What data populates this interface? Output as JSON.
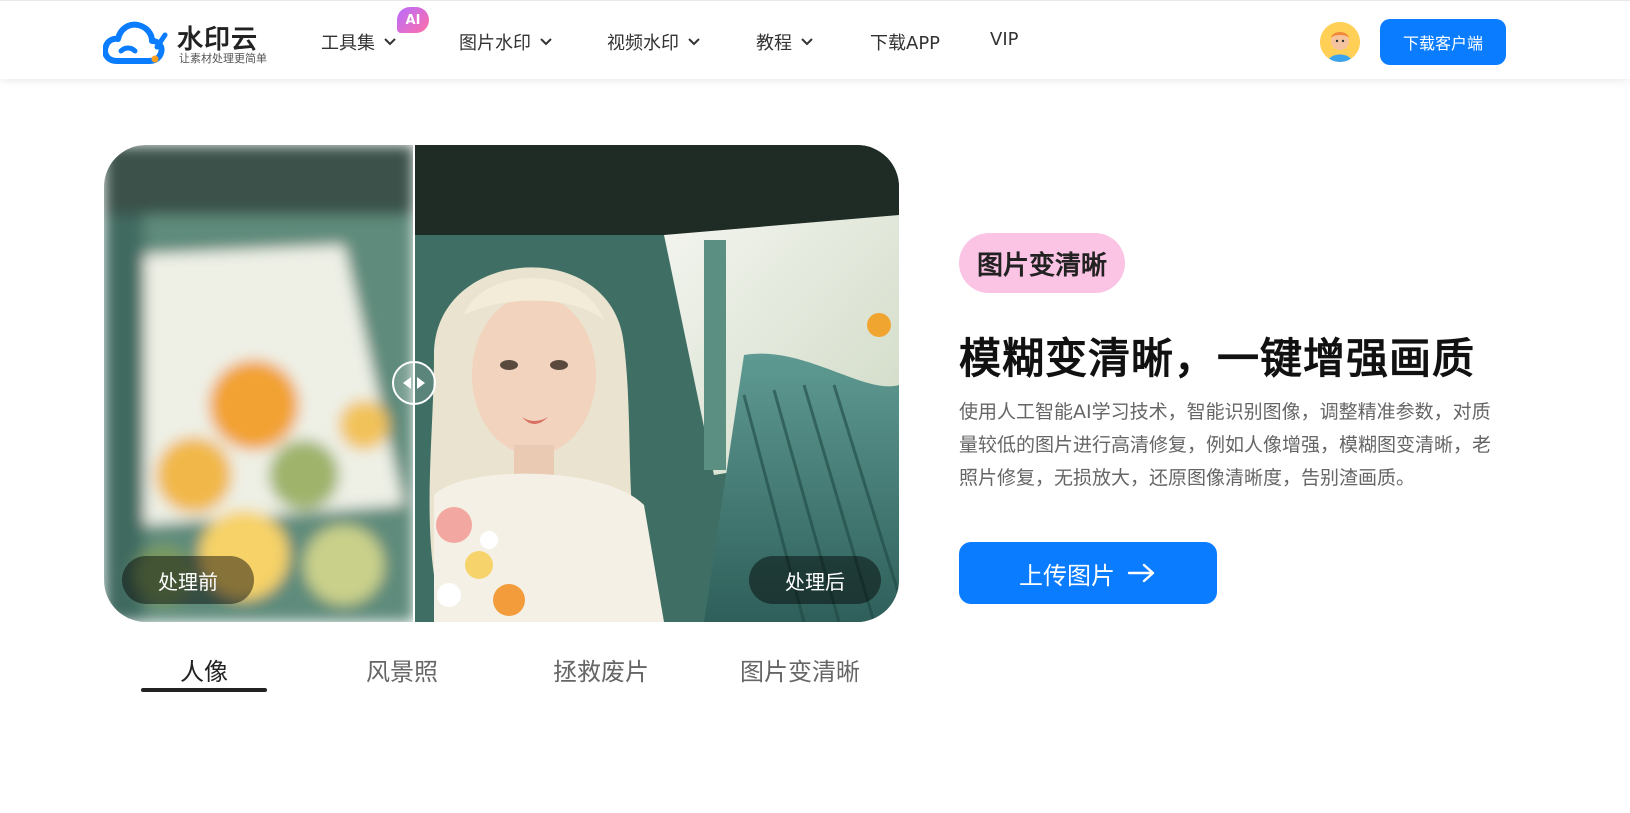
{
  "header": {
    "logo_text": "水印云",
    "logo_slogan": "让素材处理更简单",
    "ai_badge": "AI",
    "nav": [
      {
        "label": "工具集",
        "has_dropdown": true
      },
      {
        "label": "图片水印",
        "has_dropdown": true
      },
      {
        "label": "视频水印",
        "has_dropdown": true
      },
      {
        "label": "教程",
        "has_dropdown": true
      },
      {
        "label": "下载APP",
        "has_dropdown": false
      },
      {
        "label": "VIP",
        "has_dropdown": false
      }
    ],
    "download_button": "下载客户端"
  },
  "compare": {
    "before_label": "处理前",
    "after_label": "处理后"
  },
  "tabs": [
    {
      "label": "人像",
      "active": true
    },
    {
      "label": "风景照",
      "active": false
    },
    {
      "label": "拯救废片",
      "active": false
    },
    {
      "label": "图片变清晰",
      "active": false
    }
  ],
  "feature": {
    "tag": "图片变清晰",
    "headline": "模糊变清晰，一键增强画质",
    "description": "使用人工智能AI学习技术，智能识别图像，调整精准参数，对质量较低的图片进行高清修复，例如人像增强，模糊图变清晰，老照片修复，无损放大，还原图像清晰度，告别渣画质。",
    "upload_button": "上传图片"
  },
  "colors": {
    "primary": "#0a7cff",
    "tag_bg": "#fbc3e4",
    "ai_badge_gradient": [
      "#b86cff",
      "#ff6fa6"
    ]
  }
}
